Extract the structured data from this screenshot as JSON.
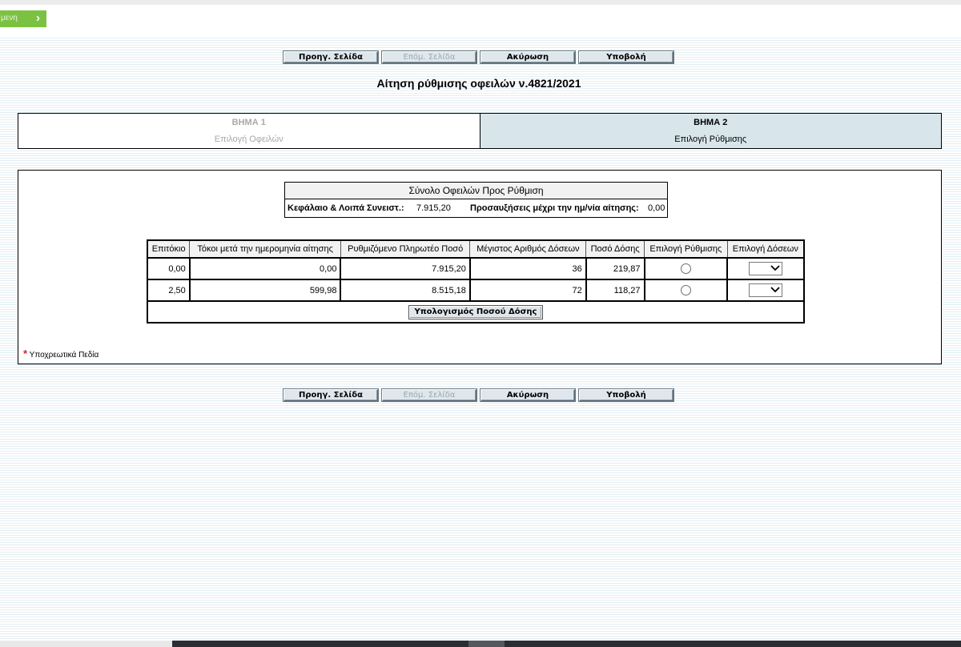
{
  "top_tab": {
    "label": "μενη",
    "arrow_icon": "chevron-right-icon"
  },
  "buttons": {
    "prev": "Προηγ. Σελίδα",
    "next": "Επόμ. Σελίδα",
    "cancel": "Ακύρωση",
    "submit": "Υποβολή"
  },
  "page_title": "Αίτηση ρύθμισης οφειλών ν.4821/2021",
  "steps": [
    {
      "number": "ΒΗΜΑ 1",
      "label": "Επιλογή Οφειλών",
      "active": false
    },
    {
      "number": "ΒΗΜΑ 2",
      "label": "Επιλογή Ρύθμισης",
      "active": true
    }
  ],
  "summary": {
    "header": "Σύνολο Οφειλών Προς Ρύθμιση",
    "principal_label": "Κεφάλαιο & Λοιπά Συνειστ.:",
    "principal_value": "7.915,20",
    "surcharges_label": "Προσαυξήσεις μέχρι την ημ/νία αίτησης:",
    "surcharges_value": "0,00"
  },
  "table": {
    "headers": [
      "Επιτόκιο",
      "Τόκοι μετά την ημερομηνία αίτησης",
      "Ρυθμιζόμενο Πληρωτέο Ποσό",
      "Μέγιστος Αριθμός Δόσεων",
      "Ποσό Δόσης",
      "Επιλογή Ρύθμισης",
      "Επιλογή Δόσεων"
    ],
    "rows": [
      {
        "rate": "0,00",
        "interest": "0,00",
        "amount": "7.915,20",
        "max_installments": "36",
        "installment": "219,87"
      },
      {
        "rate": "2,50",
        "interest": "599,98",
        "amount": "8.515,18",
        "max_installments": "72",
        "installment": "118,27"
      }
    ],
    "calc_button": "Υπολογισμός Ποσού Δόσης"
  },
  "required_note": "Υποχρεωτικά Πεδία",
  "required_marker": "*",
  "colors": {
    "accent_green": "#7cc242",
    "step_active_bg": "#d8e6ec",
    "required_star": "#e02020"
  }
}
